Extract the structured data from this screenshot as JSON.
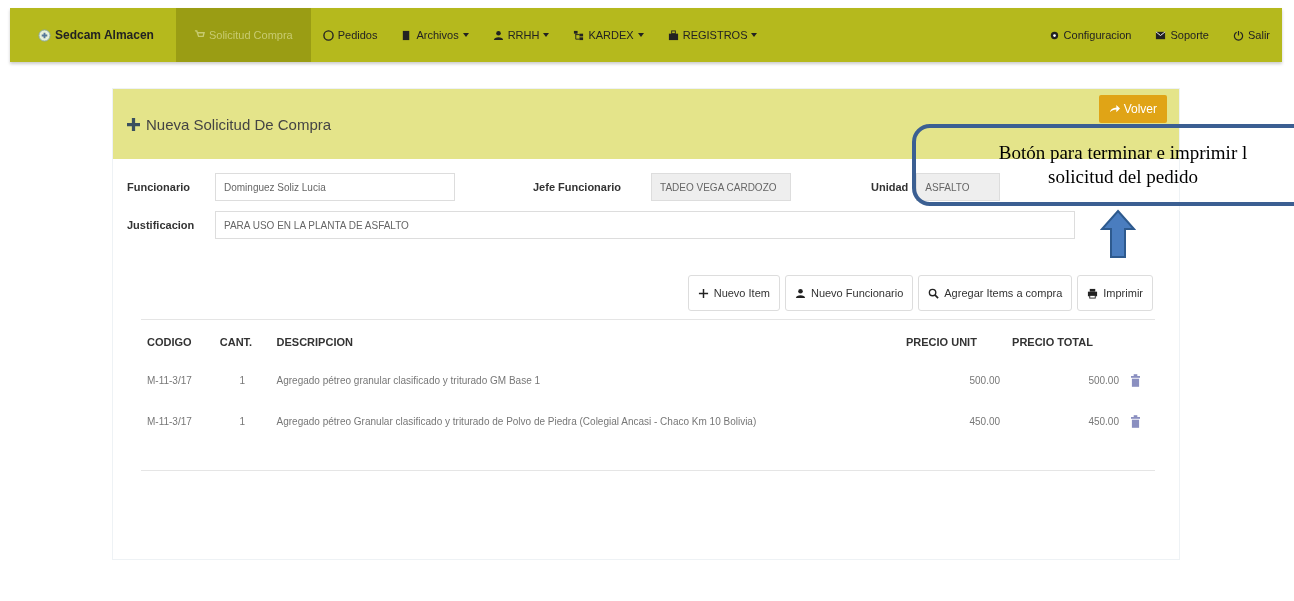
{
  "navbar": {
    "brand": "Sedcam Almacen",
    "items": [
      {
        "label": "Solicitud Compra",
        "selected": true,
        "dropdown": false
      },
      {
        "label": "Pedidos",
        "selected": false,
        "dropdown": false
      },
      {
        "label": "Archivos",
        "selected": false,
        "dropdown": true
      },
      {
        "label": "RRHH",
        "selected": false,
        "dropdown": true
      },
      {
        "label": "KARDEX",
        "selected": false,
        "dropdown": true
      },
      {
        "label": "REGISTROS",
        "selected": false,
        "dropdown": true
      }
    ],
    "right_items": [
      {
        "label": "Configuracion"
      },
      {
        "label": "Soporte"
      },
      {
        "label": "Salir"
      }
    ]
  },
  "panel": {
    "title": "Nueva Solicitud De Compra",
    "back_button": "Volver"
  },
  "form": {
    "funcionario": {
      "label": "Funcionario",
      "value": "Dominguez Soliz Lucia"
    },
    "jefe": {
      "label": "Jefe Funcionario",
      "value": "TADEO VEGA CARDOZO"
    },
    "unidad": {
      "label": "Unidad",
      "value": "ASFALTO"
    },
    "justificacion": {
      "label": "Justificacion",
      "value": "PARA USO EN LA PLANTA DE ASFALTO"
    }
  },
  "actions": [
    {
      "label": "Nuevo Item"
    },
    {
      "label": "Nuevo Funcionario"
    },
    {
      "label": "Agregar Items a compra"
    },
    {
      "label": "Imprimir"
    }
  ],
  "table": {
    "columns": [
      "CODIGO",
      "CANT.",
      "DESCRIPCION",
      "PRECIO UNIT",
      "PRECIO TOTAL"
    ],
    "rows": [
      [
        "M-11-3/17",
        "1",
        "Agregado pétreo granular clasificado y triturado GM Base 1",
        "500.00",
        "500.00"
      ],
      [
        "M-11-3/17",
        "1",
        "Agregado pétreo Granular clasificado y triturado de Polvo de Piedra (Colegial Ancasi - Chaco Km 10 Bolivia)",
        "450.00",
        "450.00"
      ]
    ]
  },
  "annotation": {
    "lines": [
      "Botón para terminar e imprimir l",
      "solicitud del pedido"
    ]
  }
}
